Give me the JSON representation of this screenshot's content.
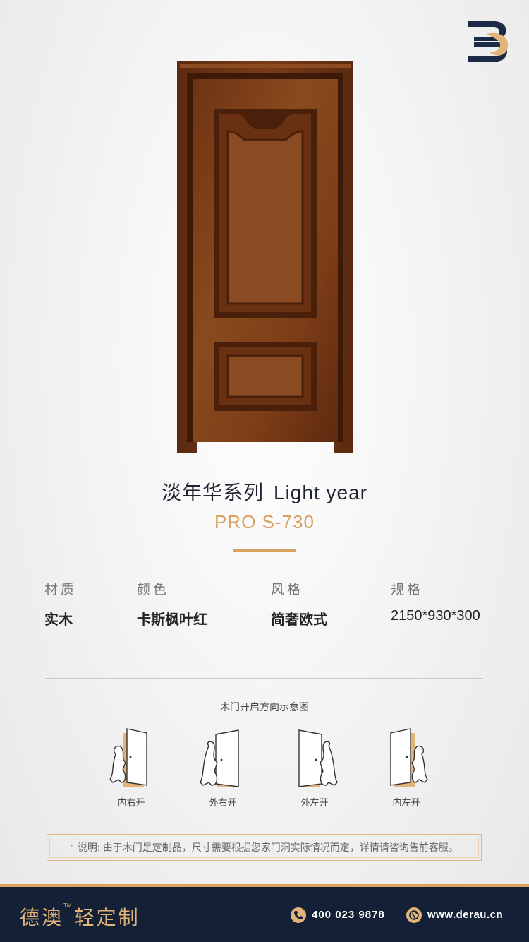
{
  "product": {
    "series_cn": "淡年华系列",
    "series_en": "Light year",
    "model": "PRO S-730"
  },
  "specs": [
    {
      "label": "材质",
      "value": "实木"
    },
    {
      "label": "颜色",
      "value": "卡斯枫叶红"
    },
    {
      "label": "风格",
      "value": "简奢欧式"
    },
    {
      "label": "规格",
      "value": "2150*930*300"
    }
  ],
  "diagram": {
    "title": "木门开启方向示意图",
    "items": [
      {
        "label": "内右开"
      },
      {
        "label": "外右开"
      },
      {
        "label": "外左开"
      },
      {
        "label": "内左开"
      }
    ]
  },
  "note": {
    "star": "*",
    "text": "说明: 由于木门是定制品，尺寸需要根据您家门洞实际情况而定，详情请咨询售前客服。"
  },
  "footer": {
    "brand": "德澳",
    "tm": "TM",
    "brand_suffix": "轻定制",
    "phone": "400 023 9878",
    "website": "www.derau.cn"
  },
  "colors": {
    "accent": "#d9a25f",
    "footer_bg": "#142036",
    "door_wood": "#7a3b17"
  }
}
